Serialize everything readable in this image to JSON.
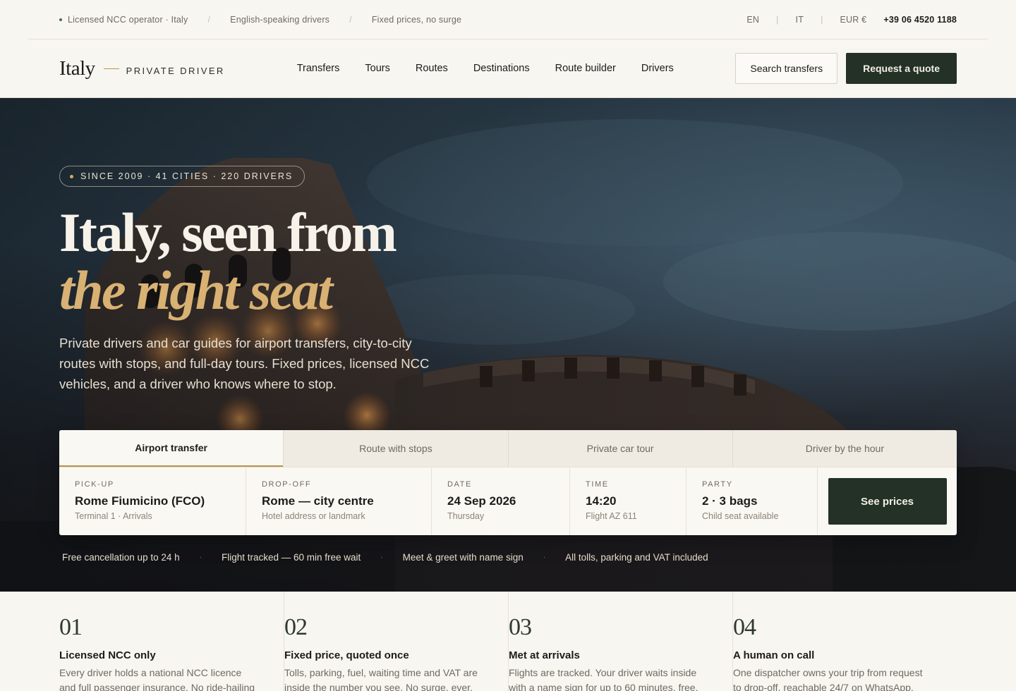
{
  "topbar": {
    "items": [
      "Licensed NCC operator · Italy",
      "English-speaking drivers",
      "Fixed prices, no surge"
    ],
    "lang_en": "EN",
    "lang_it": "IT",
    "currency": "EUR €",
    "phone": "+39 06 4520 1188"
  },
  "nav": {
    "logo_word": "Italy",
    "logo_sub": "PRIVATE DRIVER",
    "menu": [
      "Transfers",
      "Tours",
      "Routes",
      "Destinations",
      "Route builder",
      "Drivers"
    ],
    "search_label": "Search transfers",
    "quote_label": "Request a quote"
  },
  "hero": {
    "badge": "SINCE 2009 · 41 CITIES · 220 DRIVERS",
    "headline_line1": "Italy, seen from",
    "headline_line2": "the right seat",
    "lede": "Private drivers and car guides for airport transfers, city-to-city routes with stops, and full-day tours. Fixed prices, licensed NCC vehicles, and a driver who knows where to stop."
  },
  "booking": {
    "tabs": [
      "Airport transfer",
      "Route with stops",
      "Private car tour",
      "Driver by the hour"
    ],
    "active_tab": 0,
    "fields": [
      {
        "label": "PICK-UP",
        "value": "Rome Fiumicino (FCO)",
        "hint": "Terminal 1 · Arrivals"
      },
      {
        "label": "DROP-OFF",
        "value": "Rome — city centre",
        "hint": "Hotel address or landmark"
      },
      {
        "label": "DATE",
        "value": "24 Sep 2026",
        "hint": "Thursday"
      },
      {
        "label": "TIME",
        "value": "14:20",
        "hint": "Flight AZ 611"
      },
      {
        "label": "PARTY",
        "value": "2 · 3 bags",
        "hint": "Child seat available"
      }
    ],
    "submit_label": "See prices"
  },
  "perks": [
    "Free cancellation up to 24 h",
    "Flight tracked — 60 min free wait",
    "Meet & greet with name sign",
    "All tolls, parking and VAT included"
  ],
  "features": [
    {
      "num": "01",
      "title": "Licensed NCC only",
      "desc": "Every driver holds a national NCC licence and full passenger insurance. No ride-hailing"
    },
    {
      "num": "02",
      "title": "Fixed price, quoted once",
      "desc": "Tolls, parking, fuel, waiting time and VAT are inside the number you see. No surge, ever."
    },
    {
      "num": "03",
      "title": "Met at arrivals",
      "desc": "Flights are tracked. Your driver waits inside with a name sign for up to 60 minutes, free."
    },
    {
      "num": "04",
      "title": "A human on call",
      "desc": "One dispatcher owns your trip from request to drop-off, reachable 24/7 on WhatsApp."
    }
  ],
  "colors": {
    "accent": "#b8924f",
    "brand_dark": "#233126",
    "headline_accent": "#d9b173",
    "background": "#f8f6f1"
  }
}
